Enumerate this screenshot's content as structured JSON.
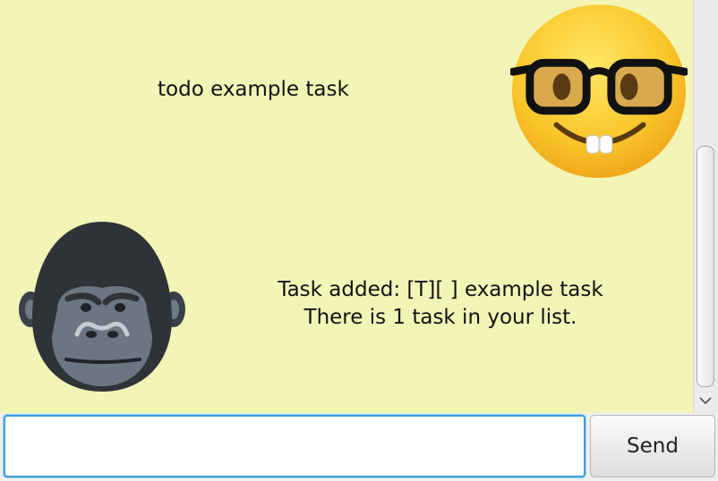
{
  "dialog": {
    "background": "#f3f5b6",
    "messages": [
      {
        "sender": "user",
        "avatar": "nerd-face-icon",
        "text": "todo example task"
      },
      {
        "sender": "bot",
        "avatar": "gorilla-icon",
        "text": "Task added: [T][ ] example task\nThere is 1 task in your list."
      }
    ]
  },
  "input": {
    "value": "",
    "placeholder": ""
  },
  "send_button": {
    "label": "Send"
  },
  "colors": {
    "input_focus_border": "#3aa0df"
  }
}
